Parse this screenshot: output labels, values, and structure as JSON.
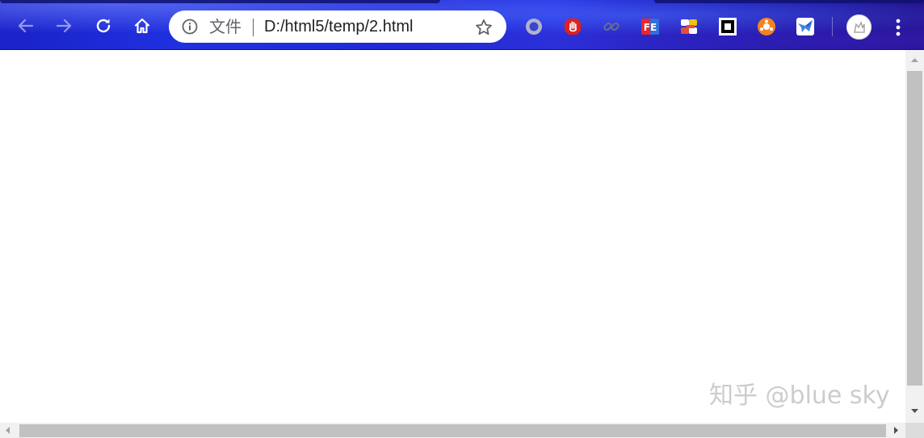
{
  "browser": {
    "omnibox": {
      "scheme_label": "文件",
      "url": "D:/html5/temp/2.html"
    },
    "icons": {
      "back": "back-arrow-icon",
      "forward": "forward-arrow-icon",
      "reload": "reload-icon",
      "home": "home-icon",
      "info": "info-icon",
      "bookmark": "star-icon",
      "menu": "kebab-menu-icon"
    },
    "extensions": [
      "grey-circle-extension-icon",
      "red-hand-extension-icon",
      "link-extension-icon",
      "fe-extension-icon",
      "colorful-extension-icon",
      "black-square-extension-icon",
      "orange-extension-icon",
      "blue-bird-extension-icon"
    ],
    "extension_labels": {
      "fe": "FE"
    },
    "colors": {
      "toolbar": "#1e2ad8",
      "omnibox_bg": "#ffffff",
      "scrollbar_thumb": "#c1c1c1"
    }
  },
  "page": {
    "content": ""
  },
  "watermark": {
    "text": "知乎 @blue sky"
  }
}
